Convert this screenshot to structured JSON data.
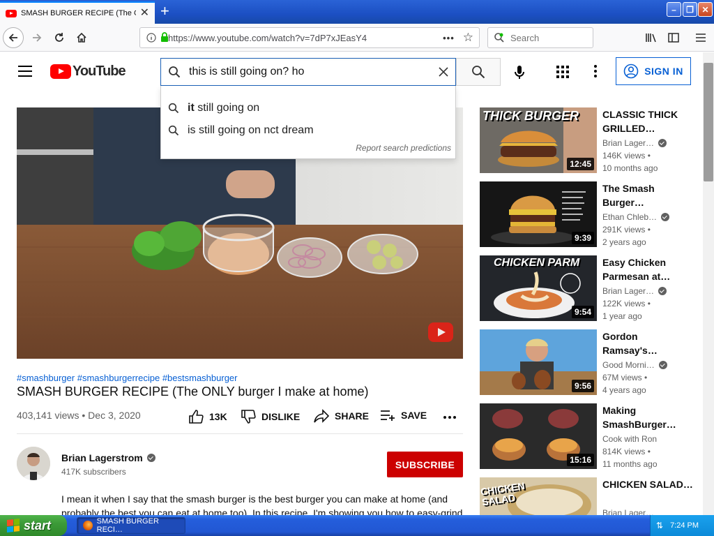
{
  "browser": {
    "tab_title": "SMASH BURGER RECIPE (The ONLY",
    "url": "https://www.youtube.com/watch?v=7dP7xJEasY4",
    "search_placeholder": "Search"
  },
  "youtube": {
    "logo_text": "YouTube",
    "search_query": "this is still going on? ho",
    "suggestions": [
      {
        "bold": "it",
        "rest": " still going on"
      },
      {
        "bold": "",
        "rest": "is still going on nct dream"
      }
    ],
    "report_text": "Report search predictions",
    "signin_label": "SIGN IN"
  },
  "video": {
    "hashtags": "#smashburger #smashburgerrecipe #bestsmashburger",
    "title": "SMASH BURGER RECIPE (The ONLY burger I make at home)",
    "meta": "403,141 views • Dec 3, 2020",
    "likes": "13K",
    "dislike_label": "DISLIKE",
    "share_label": "SHARE",
    "save_label": "SAVE",
    "channel": "Brian Lagerstrom",
    "subscribers": "417K subscribers",
    "subscribe_label": "SUBSCRIBE",
    "description": "I mean it when I say that the smash burger is the best burger you can make at home (and probably the best you can eat at home too). In this recipe, I'm showing you how to easy-grind"
  },
  "recommendations": [
    {
      "thumb_text": "THICK BURGER",
      "title": "CLASSIC THICK GRILLED…",
      "channel": "Brian Lager…",
      "verified": true,
      "views": "146K views •",
      "age": "10 months ago",
      "duration": "12:45"
    },
    {
      "thumb_text": "",
      "title": "The Smash Burger…",
      "channel": "Ethan Chleb…",
      "verified": true,
      "views": "291K views •",
      "age": "2 years ago",
      "duration": "9:39"
    },
    {
      "thumb_text": "CHICKEN PARM",
      "title": "Easy Chicken Parmesan at…",
      "channel": "Brian Lager…",
      "verified": true,
      "views": "122K views •",
      "age": "1 year ago",
      "duration": "9:54"
    },
    {
      "thumb_text": "",
      "title": "Gordon Ramsay's…",
      "channel": "Good Morni…",
      "verified": true,
      "views": "67M views •",
      "age": "4 years ago",
      "duration": "9:56"
    },
    {
      "thumb_text": "",
      "title": "Making SmashBurger…",
      "channel": "Cook with Ron",
      "verified": false,
      "views": "814K views •",
      "age": "11 months ago",
      "duration": "15:16"
    },
    {
      "thumb_text": "CHICKEN SALAD",
      "title": "CHICKEN SALAD…",
      "channel": "Brian Lager…",
      "verified": false,
      "views": "",
      "age": "",
      "duration": ""
    }
  ],
  "taskbar": {
    "start_label": "start",
    "task_label": "SMASH BURGER RECI…",
    "clock": "7:24 PM"
  },
  "colors": {
    "accent_red": "#cc0000",
    "link_blue": "#065fd4",
    "xp_blue": "#245edc"
  }
}
